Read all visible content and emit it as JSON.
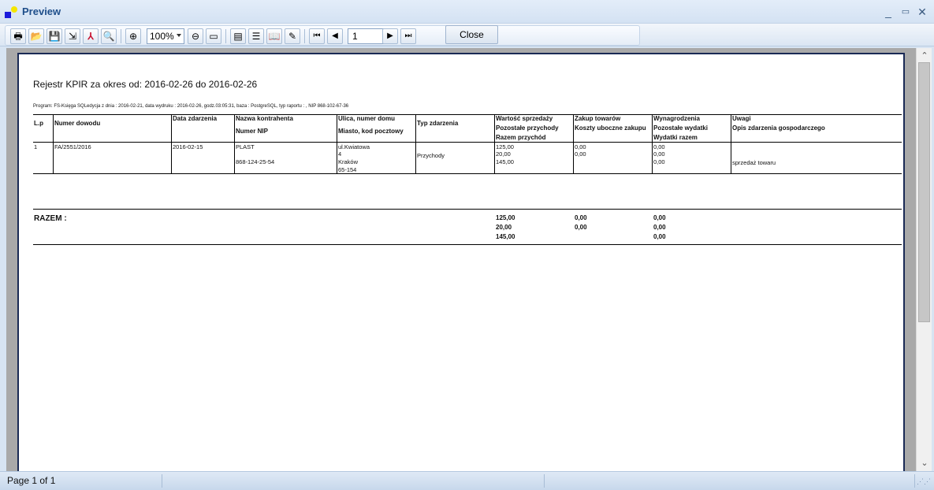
{
  "window": {
    "title": "Preview"
  },
  "toolbar": {
    "buttons": [
      {
        "name": "print-icon",
        "glyph": "🖶"
      },
      {
        "name": "open-folder-icon",
        "glyph": "📂"
      },
      {
        "name": "save-icon",
        "glyph": "💾"
      },
      {
        "name": "export-icon",
        "glyph": "⇲"
      },
      {
        "name": "pdf-icon",
        "glyph": "⅄"
      },
      {
        "name": "find-icon",
        "glyph": "🔍"
      },
      {
        "name": "zoom-in-icon",
        "glyph": "⊕"
      },
      {
        "name": "zoom-out-icon",
        "glyph": "⊖"
      },
      {
        "name": "full-page-icon",
        "glyph": "▭"
      },
      {
        "name": "single-page-icon",
        "glyph": "▤"
      },
      {
        "name": "multi-page-icon",
        "glyph": "☰"
      },
      {
        "name": "book-icon",
        "glyph": "📖"
      },
      {
        "name": "edit-icon",
        "glyph": "✎"
      },
      {
        "name": "first-page-icon",
        "glyph": "⏮"
      },
      {
        "name": "prev-page-icon",
        "glyph": "◀"
      },
      {
        "name": "next-page-icon",
        "glyph": "▶"
      },
      {
        "name": "last-page-icon",
        "glyph": "⏭"
      }
    ],
    "zoom": "100%",
    "page_number": "1",
    "close_label": "Close"
  },
  "report": {
    "title": "Rejestr KPIR za okres od: 2016-02-26 do 2016-02-26",
    "info": "Program: FS-Księga SQLedycja z dnia : 2016-02-21, data wydruku : 2016-02-26, godz.03:05:31, baza : PostgreSQL, typ raportu : , NIP 868-102-67-36",
    "headers": {
      "lp": "L.p",
      "doc": "Numer dowodu",
      "date": "Data zdarzenia",
      "contractor_1": "Nazwa kontrahenta",
      "contractor_2": "Numer NIP",
      "street_1": "Ulica, numer domu",
      "street_2": "Miasto, kod pocztowy",
      "type": "Typ zdarzenia",
      "sales_1": "Wartość sprzedaży",
      "sales_2": "Pozostałe przychody",
      "sales_3": "Razem przychód",
      "purchase_1": "Zakup towarów",
      "purchase_2": "Koszty uboczne zakupu",
      "wages_1": "Wynagrodzenia",
      "wages_2": "Pozostałe wydatki",
      "wages_3": "Wydatki razem",
      "notes_1": "Uwagi",
      "notes_2": "Opis zdarzenia gospodarczego"
    },
    "row": {
      "lp": "1",
      "doc": "FA/2551/2016",
      "date": "2016-02-15",
      "contractor_name": "PLAST",
      "nip": "868-124-25-54",
      "street": "ul.Kwiatowa",
      "house": "4",
      "city": "Kraków",
      "postal": "65-154",
      "type": "Przychody",
      "sales_1": "125,00",
      "sales_2": "20,00",
      "sales_3": "145,00",
      "purchase_1": "0,00",
      "purchase_2": "0,00",
      "wages_1": "0,00",
      "wages_2": "0,00",
      "wages_3": "0,00",
      "description": "sprzedaż towaru"
    },
    "totals": {
      "label": "RAZEM :",
      "sales_1": "125,00",
      "sales_2": "20,00",
      "sales_3": "145,00",
      "purchase_1": "0,00",
      "purchase_2": "0,00",
      "wages_1": "0,00",
      "wages_2": "0,00",
      "wages_3": "0,00"
    }
  },
  "status": {
    "page_info": "Page 1 of 1"
  }
}
